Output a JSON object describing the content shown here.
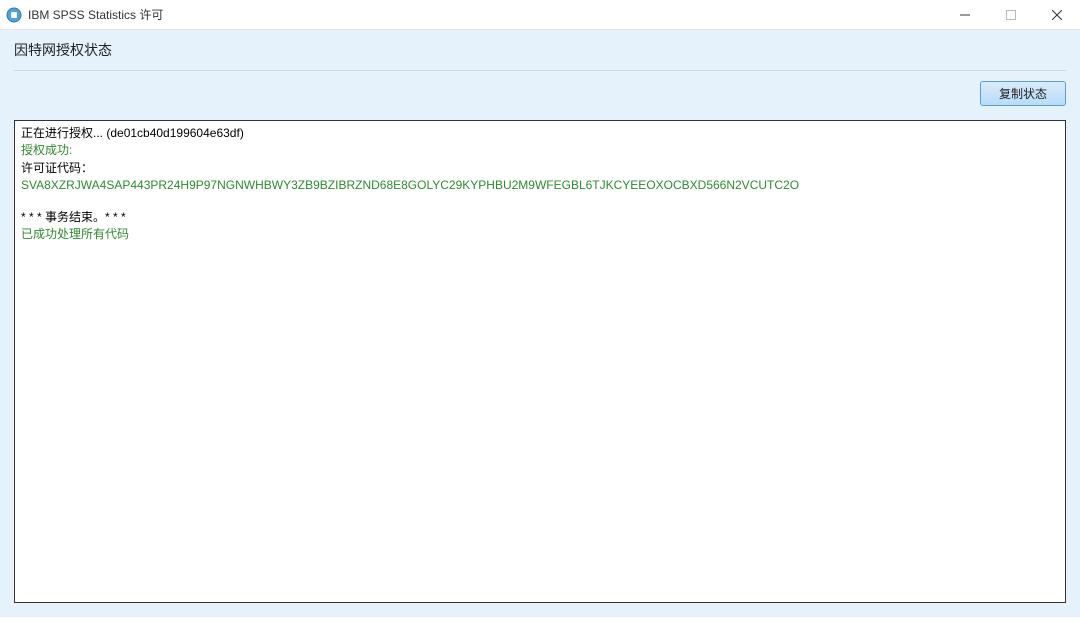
{
  "window": {
    "title": "IBM SPSS Statistics 许可"
  },
  "header": {
    "heading": "因特网授权状态",
    "copy_button_label": "复制状态"
  },
  "status": {
    "authorizing_prefix": "正在进行授权... (",
    "authorizing_id": "de01cb40d199604e63df",
    "authorizing_suffix": ")",
    "success_label": "授权成功:",
    "license_code_label": "许可证代码：",
    "license_code": "SVA8XZRJWA4SAP443PR24H9P97NGNWHBWY3ZB9BZIBRZND68E8GOLYC29KYPHBU2M9WFEGBL6TJKCYEEOXOCBXD566N2VCUTC2O",
    "txn_end": " * * * 事务结束。* * *",
    "all_processed": "已成功处理所有代码"
  }
}
